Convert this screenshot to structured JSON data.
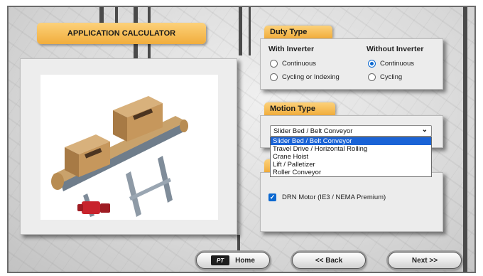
{
  "app": {
    "title": "APPLICATION CALCULATOR"
  },
  "illustration": {
    "icon": "belt-conveyor-with-boxes-illustration"
  },
  "duty_type": {
    "label": "Duty Type",
    "with_inverter": {
      "heading": "With Inverter",
      "options": [
        "Continuous",
        "Cycling or Indexing"
      ],
      "selected": null
    },
    "without_inverter": {
      "heading": "Without Inverter",
      "options": [
        "Continuous",
        "Cycling"
      ],
      "selected": "Continuous"
    }
  },
  "motion_type": {
    "label": "Motion Type",
    "selected": "Slider Bed / Belt Conveyor",
    "options": [
      "Slider Bed / Belt Conveyor",
      "Travel Drive / Horizontal Rolling",
      "Crane Hoist",
      "Lift / Palletizer",
      "Roller Conveyor"
    ]
  },
  "motor_option": {
    "label": "DRN Motor (IE3 / NEMA Premium)",
    "checked": true
  },
  "footer": {
    "home_label": "Home",
    "home_logo": "PT",
    "back_label": "<< Back",
    "next_label": "Next >>"
  },
  "colors": {
    "tab_gold": "#f1ad3c",
    "accent_blue": "#0b68d0",
    "highlight": "#1a63d6"
  }
}
